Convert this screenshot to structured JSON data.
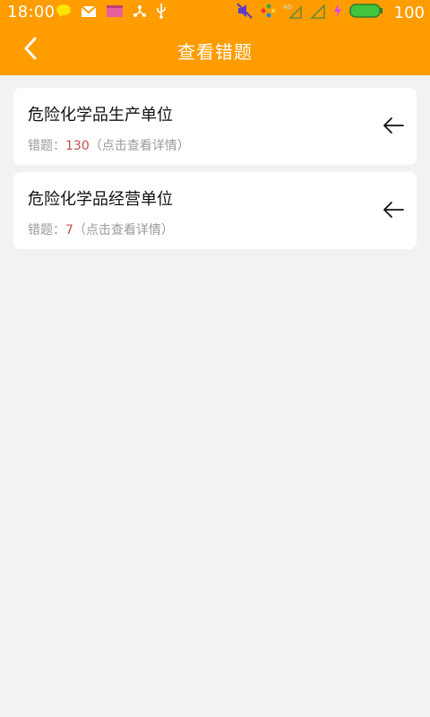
{
  "status_bar": {
    "time": "18:00",
    "battery_percent": "100",
    "icons_left": [
      "chat-bubble-icon",
      "mail-icon",
      "calendar-icon",
      "share-network-icon",
      "usb-icon"
    ],
    "icons_right": [
      "mute-icon",
      "network-icon",
      "4g-signal-icon",
      "signal-icon",
      "charging-icon",
      "battery-icon"
    ]
  },
  "header": {
    "title": "查看错题",
    "back_icon": "chevron-left-icon",
    "background_color": "#ff9c00"
  },
  "list": {
    "items": [
      {
        "title": "危险化学品生产单位",
        "count_label": "错题：",
        "count": "130",
        "hint": "（点击查看详情）",
        "icon": "arrow-left-icon"
      },
      {
        "title": "危险化学品经营单位",
        "count_label": "错题：",
        "count": "7",
        "hint": "（点击查看详情）",
        "icon": "arrow-left-icon"
      }
    ]
  }
}
